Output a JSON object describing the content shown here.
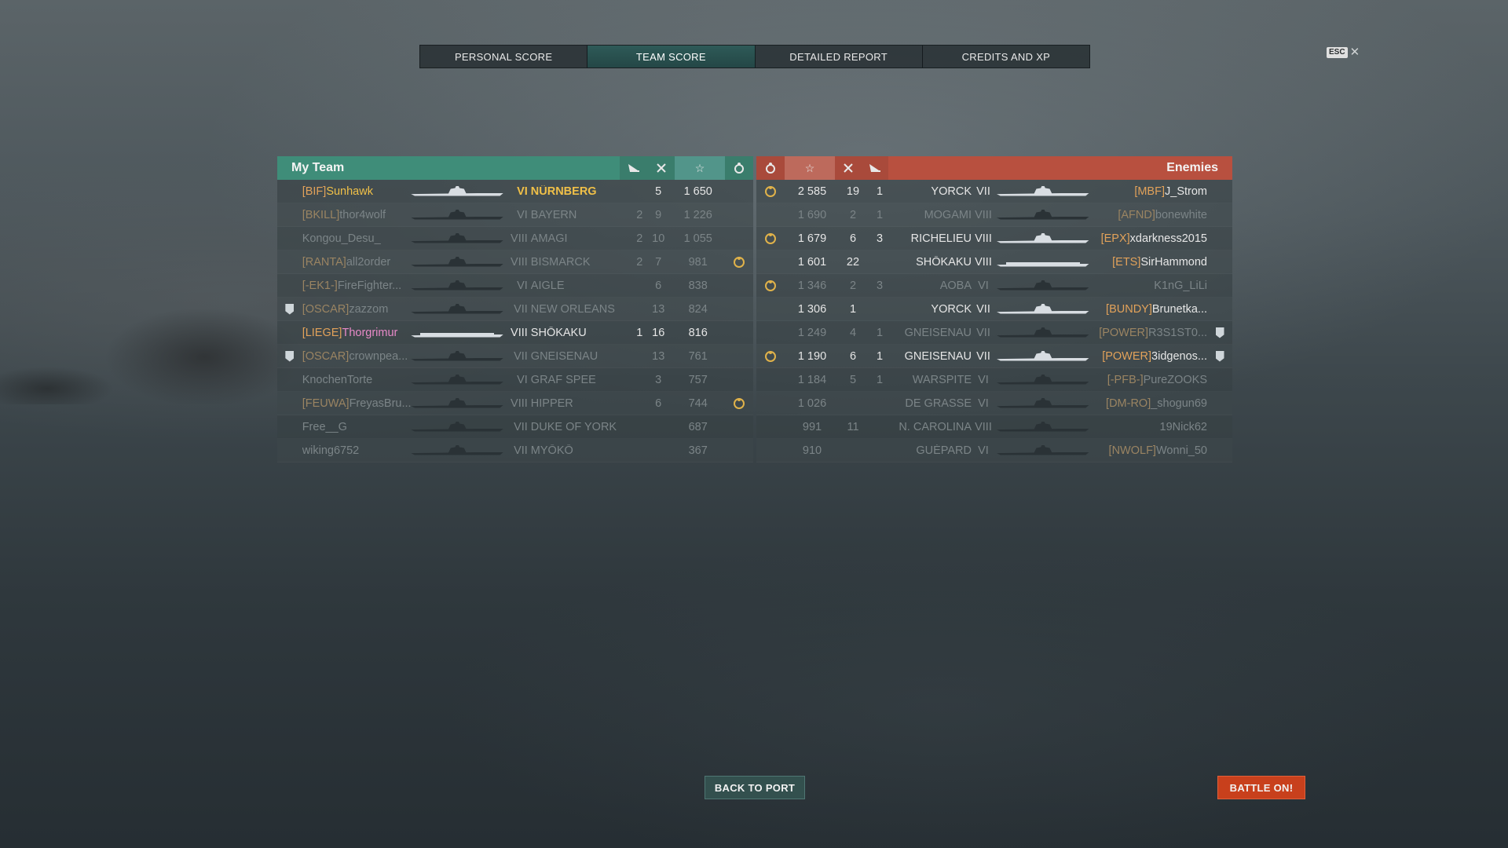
{
  "tabs": [
    {
      "label": "PERSONAL SCORE",
      "active": false
    },
    {
      "label": "TEAM SCORE",
      "active": true
    },
    {
      "label": "DETAILED REPORT",
      "active": false
    },
    {
      "label": "CREDITS AND XP",
      "active": false
    }
  ],
  "esc": {
    "key": "ESC",
    "close": "✕"
  },
  "my_team": {
    "title": "My Team",
    "columns": [
      "aircraft-destroyed-icon",
      "warships-destroyed-icon",
      "★",
      "achievement-icon"
    ],
    "rows": [
      {
        "clan": "[BIF]",
        "player": "Sunhawk",
        "tier": "VI",
        "ship": "NÜRNBERG",
        "c1": "",
        "c2": "5",
        "xp": "1 650",
        "ach": false,
        "badge": false,
        "alive": true,
        "self": true
      },
      {
        "clan": "[BKILL]",
        "player": "thor4wolf",
        "tier": "VI",
        "ship": "BAYERN",
        "c1": "2",
        "c2": "9",
        "xp": "1 226",
        "ach": false,
        "badge": false,
        "alive": false
      },
      {
        "clan": "",
        "player": "Kongou_Desu_",
        "tier": "VIII",
        "ship": "AMAGI",
        "c1": "2",
        "c2": "10",
        "xp": "1 055",
        "ach": false,
        "badge": false,
        "alive": false
      },
      {
        "clan": "[RANTA]",
        "player": "all2order",
        "tier": "VIII",
        "ship": "BISMARCK",
        "c1": "2",
        "c2": "7",
        "xp": "981",
        "ach": true,
        "badge": false,
        "alive": false
      },
      {
        "clan": "[-EK1-]",
        "player": "FireFighter...",
        "tier": "VI",
        "ship": "AIGLE",
        "c1": "",
        "c2": "6",
        "xp": "838",
        "ach": false,
        "badge": false,
        "alive": false
      },
      {
        "clan": "[OSCAR]",
        "player": "zazzom",
        "tier": "VII",
        "ship": "NEW ORLEANS",
        "c1": "",
        "c2": "13",
        "xp": "824",
        "ach": false,
        "badge": true,
        "alive": false
      },
      {
        "clan": "[LIEGE]",
        "player": "Thorgrimur",
        "tier": "VIII",
        "ship": "SHŌKAKU",
        "c1": "1",
        "c2": "16",
        "xp": "816",
        "ach": false,
        "badge": false,
        "alive": true,
        "pink": true
      },
      {
        "clan": "[OSCAR]",
        "player": "crownpea...",
        "tier": "VII",
        "ship": "GNEISENAU",
        "c1": "",
        "c2": "13",
        "xp": "761",
        "ach": false,
        "badge": true,
        "alive": false
      },
      {
        "clan": "",
        "player": "KnochenTorte",
        "tier": "VI",
        "ship": "GRAF SPEE",
        "c1": "",
        "c2": "3",
        "xp": "757",
        "ach": false,
        "badge": false,
        "alive": false
      },
      {
        "clan": "[FEUWA]",
        "player": "FreyasBru...",
        "tier": "VIII",
        "ship": "HIPPER",
        "c1": "",
        "c2": "6",
        "xp": "744",
        "ach": true,
        "badge": false,
        "alive": false
      },
      {
        "clan": "",
        "player": "Free__G",
        "tier": "VII",
        "ship": "DUKE OF YORK",
        "c1": "",
        "c2": "",
        "xp": "687",
        "ach": false,
        "badge": false,
        "alive": false
      },
      {
        "clan": "",
        "player": "wiking6752",
        "tier": "VII",
        "ship": "MYŌKŌ",
        "c1": "",
        "c2": "",
        "xp": "367",
        "ach": false,
        "badge": false,
        "alive": false
      }
    ]
  },
  "enemies": {
    "title": "Enemies",
    "rows": [
      {
        "ach": true,
        "xp": "2 585",
        "c2": "19",
        "c1": "1",
        "ship": "YORCK",
        "tier": "VII",
        "clan": "[MBF]",
        "player": "J_Strom",
        "alive": true,
        "badge": false
      },
      {
        "ach": false,
        "xp": "1 690",
        "c2": "2",
        "c1": "1",
        "ship": "MOGAMI",
        "tier": "VIII",
        "clan": "[AFND]",
        "player": "bonewhite",
        "alive": false,
        "badge": false
      },
      {
        "ach": true,
        "xp": "1 679",
        "c2": "6",
        "c1": "3",
        "ship": "RICHELIEU",
        "tier": "VIII",
        "clan": "[EPX]",
        "player": "xdarkness2015",
        "alive": true,
        "badge": false
      },
      {
        "ach": false,
        "xp": "1 601",
        "c2": "22",
        "c1": "",
        "ship": "SHŌKAKU",
        "tier": "VIII",
        "clan": "[ETS]",
        "player": "SirHammond",
        "alive": true,
        "badge": false
      },
      {
        "ach": true,
        "xp": "1 346",
        "c2": "2",
        "c1": "3",
        "ship": "AOBA",
        "tier": "VI",
        "clan": "",
        "player": "K1nG_LiLi",
        "alive": false,
        "badge": false
      },
      {
        "ach": false,
        "xp": "1 306",
        "c2": "1",
        "c1": "",
        "ship": "YORCK",
        "tier": "VII",
        "clan": "[BUNDY]",
        "player": "Brunetka...",
        "alive": true,
        "badge": false
      },
      {
        "ach": false,
        "xp": "1 249",
        "c2": "4",
        "c1": "1",
        "ship": "GNEISENAU",
        "tier": "VII",
        "clan": "[POWER]",
        "player": "R3S1ST0...",
        "alive": false,
        "badge": true
      },
      {
        "ach": true,
        "xp": "1 190",
        "c2": "6",
        "c1": "1",
        "ship": "GNEISENAU",
        "tier": "VII",
        "clan": "[POWER]",
        "player": "3idgenos...",
        "alive": true,
        "badge": true
      },
      {
        "ach": false,
        "xp": "1 184",
        "c2": "5",
        "c1": "1",
        "ship": "WARSPITE",
        "tier": "VI",
        "clan": "[-PFB-]",
        "player": "PureZOOKS",
        "alive": false,
        "badge": false
      },
      {
        "ach": false,
        "xp": "1 026",
        "c2": "",
        "c1": "",
        "ship": "DE GRASSE",
        "tier": "VI",
        "clan": "[DM-RO]",
        "player": "_shogun69",
        "alive": false,
        "badge": false
      },
      {
        "ach": false,
        "xp": "991",
        "c2": "11",
        "c1": "",
        "ship": "N. CAROLINA",
        "tier": "VIII",
        "clan": "",
        "player": "19Nick62",
        "alive": false,
        "badge": false
      },
      {
        "ach": false,
        "xp": "910",
        "c2": "",
        "c1": "",
        "ship": "GUÉPARD",
        "tier": "VI",
        "clan": "[NWOLF]",
        "player": "Wonni_50",
        "alive": false,
        "badge": false
      }
    ]
  },
  "buttons": {
    "back": "BACK TO PORT",
    "battle": "BATTLE ON!"
  },
  "colors": {
    "my_team": "#3f8d79",
    "enemies": "#b8503f",
    "clan_tag": "#e2a25a",
    "self": "#f0c048",
    "battle_button": "#c8401c"
  }
}
